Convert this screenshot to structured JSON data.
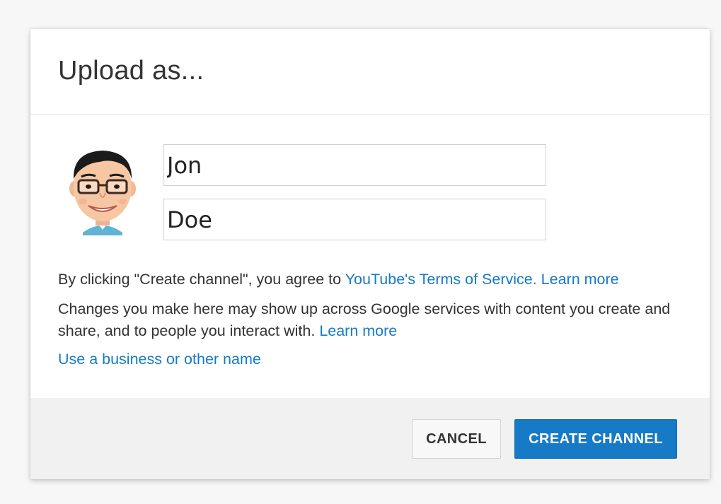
{
  "dialog": {
    "title": "Upload as..."
  },
  "form": {
    "first_name_value": "Jon",
    "last_name_value": "Doe"
  },
  "legal": {
    "terms_prefix": "By clicking \"Create channel\", you agree to ",
    "terms_link": "YouTube's Terms of Service.",
    "terms_learn_more": "Learn more",
    "changes_text": "Changes you make here may show up across Google services with content you create and share, and to people you interact with. ",
    "changes_learn_more": "Learn more",
    "business_name_link": "Use a business or other name"
  },
  "footer": {
    "cancel_label": "CANCEL",
    "create_label": "CREATE CHANNEL"
  },
  "colors": {
    "link": "#167ac6",
    "primary_button": "#167ac6",
    "footer_bg": "#f1f1f1"
  },
  "icons": {
    "avatar": "cartoon-avatar-icon"
  }
}
